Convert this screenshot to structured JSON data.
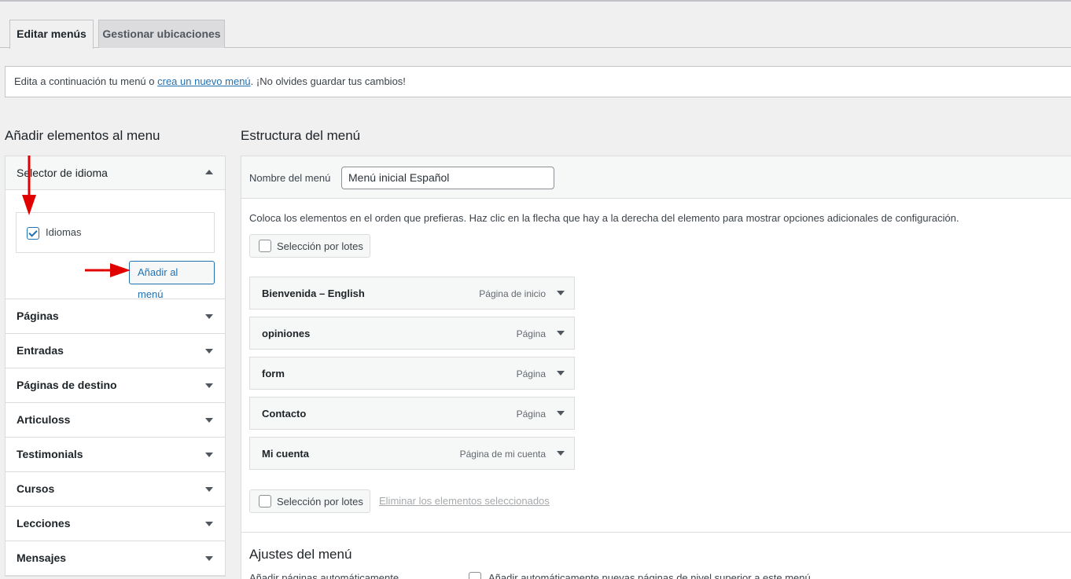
{
  "tabs": [
    {
      "label": "Editar menús",
      "active": true
    },
    {
      "label": "Gestionar ubicaciones",
      "active": false
    }
  ],
  "notice": {
    "prefix": "Edita a continuación tu menú o ",
    "link": "crea un nuevo menú",
    "suffix": ". ¡No olvides guardar tus cambios!"
  },
  "left": {
    "title": "Añadir elementos al menu",
    "open_section": {
      "label": "Selector de idioma",
      "checkbox_label": "Idiomas",
      "checkbox_checked": true,
      "add_button": "Añadir al menú"
    },
    "sections": [
      "Páginas",
      "Entradas",
      "Páginas de destino",
      "Articuloss",
      "Testimonials",
      "Cursos",
      "Lecciones",
      "Mensajes"
    ]
  },
  "right": {
    "title": "Estructura del menú",
    "name_label": "Nombre del menú",
    "name_value": "Menú inicial Español",
    "instructions": "Coloca los elementos en el orden que prefieras. Haz clic en la flecha que hay a la derecha del elemento para mostrar opciones adicionales de configuración.",
    "bulk_label": "Selección por lotes",
    "remove_label": "Eliminar los elementos seleccionados",
    "items": [
      {
        "title": "Bienvenida – English",
        "type": "Página de inicio"
      },
      {
        "title": "opiniones",
        "type": "Página"
      },
      {
        "title": "form",
        "type": "Página"
      },
      {
        "title": "Contacto",
        "type": "Página"
      },
      {
        "title": "Mi cuenta",
        "type": "Página de mi cuenta"
      }
    ],
    "settings_title": "Ajustes del menú",
    "auto_add_label": "Añadir páginas automáticamente",
    "auto_add_checkbox_label": "Añadir automáticamente nuevas páginas de nivel superior a este menú"
  },
  "colors": {
    "accent": "#2271b1",
    "annotation_arrow": "#e00000"
  }
}
